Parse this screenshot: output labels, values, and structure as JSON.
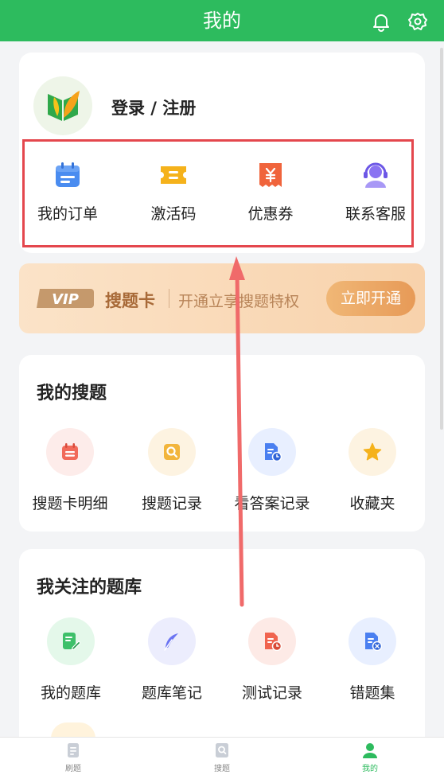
{
  "header": {
    "title": "我的",
    "bell_icon": "bell-icon",
    "settings_icon": "gear-icon"
  },
  "profile": {
    "login_label": "登录 / 注册",
    "avatar_icon": "app-logo-icon"
  },
  "quick_actions": [
    {
      "label": "我的订单",
      "icon": "calendar-list-icon",
      "color": "#4a8cf0"
    },
    {
      "label": "激活码",
      "icon": "ticket-icon",
      "color": "#f5b21b"
    },
    {
      "label": "优惠券",
      "icon": "coupon-yen-icon",
      "color": "#f0643c"
    },
    {
      "label": "联系客服",
      "icon": "headset-agent-icon",
      "color": "#8a73f2"
    }
  ],
  "vip": {
    "logo": "VIP",
    "title": "搜题卡",
    "subtitle": "开通立享搜题特权",
    "button": "立即开通"
  },
  "my_search": {
    "title": "我的搜题",
    "items": [
      {
        "label": "搜题卡明细",
        "icon": "calendar-list-icon",
        "color": "#f16a5a",
        "bg": "#fdecea"
      },
      {
        "label": "搜题记录",
        "icon": "search-doc-icon",
        "color": "#f2b53c",
        "bg": "#fdf3e1"
      },
      {
        "label": "看答案记录",
        "icon": "doc-clock-icon",
        "color": "#4a7ff0",
        "bg": "#e8efff"
      },
      {
        "label": "收藏夹",
        "icon": "star-icon",
        "color": "#f5b21b",
        "bg": "#fdf3e1"
      }
    ]
  },
  "followed_banks": {
    "title": "我关注的题库",
    "items": [
      {
        "label": "我的题库",
        "icon": "doc-edit-icon",
        "color": "#3ec06a",
        "bg": "#e4f8ea"
      },
      {
        "label": "题库笔记",
        "icon": "feather-icon",
        "color": "#6b74f2",
        "bg": "#ecedfd"
      },
      {
        "label": "测试记录",
        "icon": "doc-clock-icon",
        "color": "#f0644f",
        "bg": "#fdeae6"
      },
      {
        "label": "错题集",
        "icon": "doc-x-icon",
        "color": "#4a7ff0",
        "bg": "#e8efff"
      }
    ]
  },
  "tabbar": [
    {
      "label": "刷题",
      "icon": "doc-icon",
      "active": false
    },
    {
      "label": "搜题",
      "icon": "search-doc-icon",
      "active": false
    },
    {
      "label": "我的",
      "icon": "user-icon",
      "active": true
    }
  ],
  "colors": {
    "brand": "#2dbb5e",
    "highlight": "#e4474d",
    "vip_text": "#a86a38"
  }
}
